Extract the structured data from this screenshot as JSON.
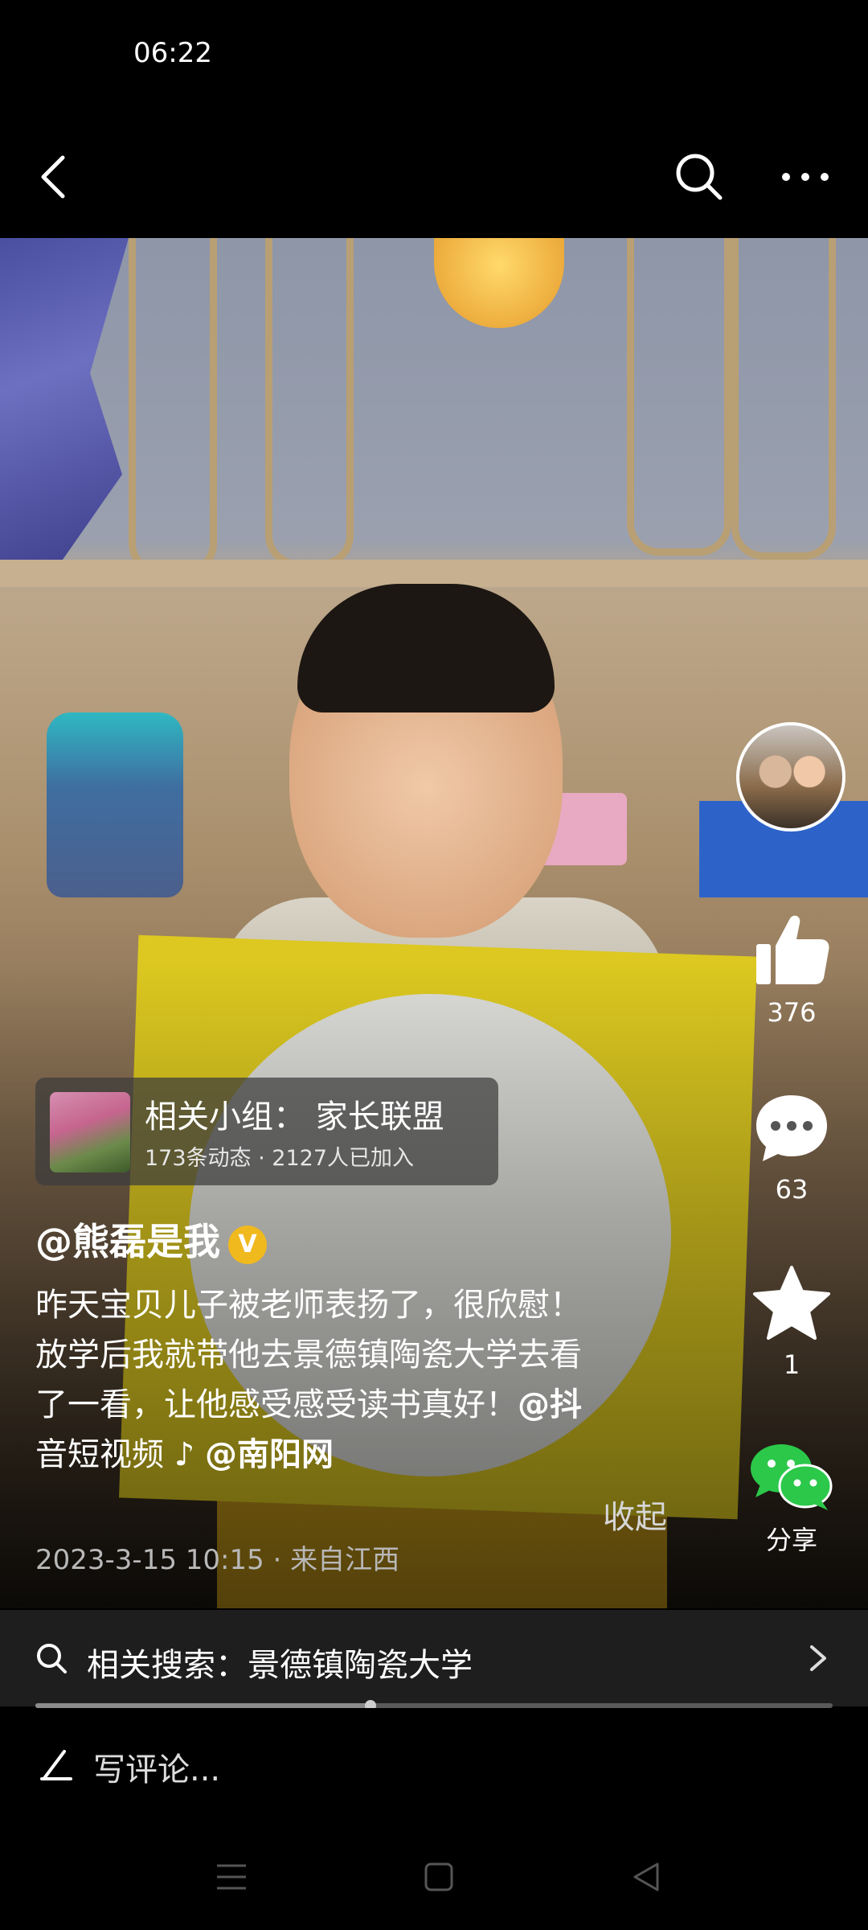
{
  "status_bar": {
    "time": "06:22"
  },
  "nav": {
    "icons": [
      "back-icon",
      "search-icon",
      "more-icon"
    ]
  },
  "author": {
    "name": "@熊磊是我",
    "verified_mark": "V"
  },
  "actions": {
    "likes": "376",
    "comments": "63",
    "favorites": "1",
    "share_label": "分享"
  },
  "group": {
    "title": "相关小组：  家长联盟",
    "stats": "173条动态 · 2127人已加入"
  },
  "caption": {
    "line1": "昨天宝贝儿子被老师表扬了，很欣慰！",
    "line2": "放学后我就带他去景德镇陶瓷大学去看",
    "line3_text": "了一看，让他感受感受读书真好！",
    "mention1": "@抖",
    "line4_text": "音短视频",
    "music_note": "♪",
    "mention2": "@南阳网",
    "collapse": "收起"
  },
  "post_meta": "2023-3-15 10:15 · 来自江西",
  "related_search": {
    "label": "相关搜索：景德镇陶瓷大学"
  },
  "progress": {
    "fraction": 0.42
  },
  "comment_input": {
    "placeholder": "写评论..."
  },
  "colors": {
    "background": "#000000",
    "verified": "#f0b91e",
    "wechat_green": "#2bc84a"
  }
}
